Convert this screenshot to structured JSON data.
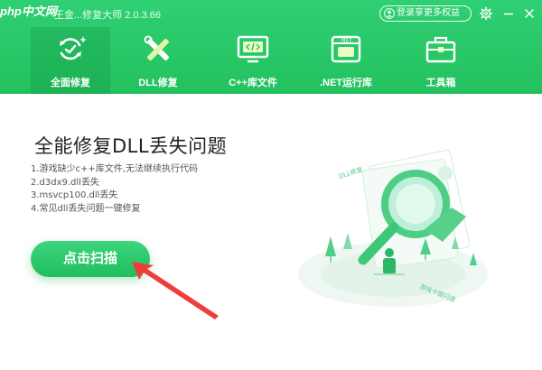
{
  "watermark": "php中文网",
  "app": {
    "title": "王金...修复大师 2.0.3.66"
  },
  "titlebar": {
    "login_label": "登录享更多权益"
  },
  "nav": {
    "tabs": [
      {
        "label": "全面修复",
        "icon": "sync-repair-icon",
        "active": true
      },
      {
        "label": "DLL修复",
        "icon": "dll-tools-icon",
        "active": false
      },
      {
        "label": "C++库文件",
        "icon": "code-monitor-icon",
        "active": false
      },
      {
        "label": ".NET运行库",
        "icon": "dotnet-window-icon",
        "active": false
      },
      {
        "label": "工具箱",
        "icon": "toolbox-icon",
        "active": false
      }
    ]
  },
  "main": {
    "title": "全能修复DLL丢失问题",
    "issues": [
      "1.游戏缺少c++库文件,无法继续执行代码",
      "2.d3dx9.dll丢失",
      "3.msvcp100.dll丢失",
      "4.常见dll丢失问题一键修复"
    ],
    "scan_button": "点击扫描"
  },
  "illustration": {
    "tag1": "DLL修复",
    "tag2": "游戏卡顿闪退"
  },
  "colors": {
    "brand_green": "#26c563",
    "annotation_red": "#ee3e3a"
  }
}
